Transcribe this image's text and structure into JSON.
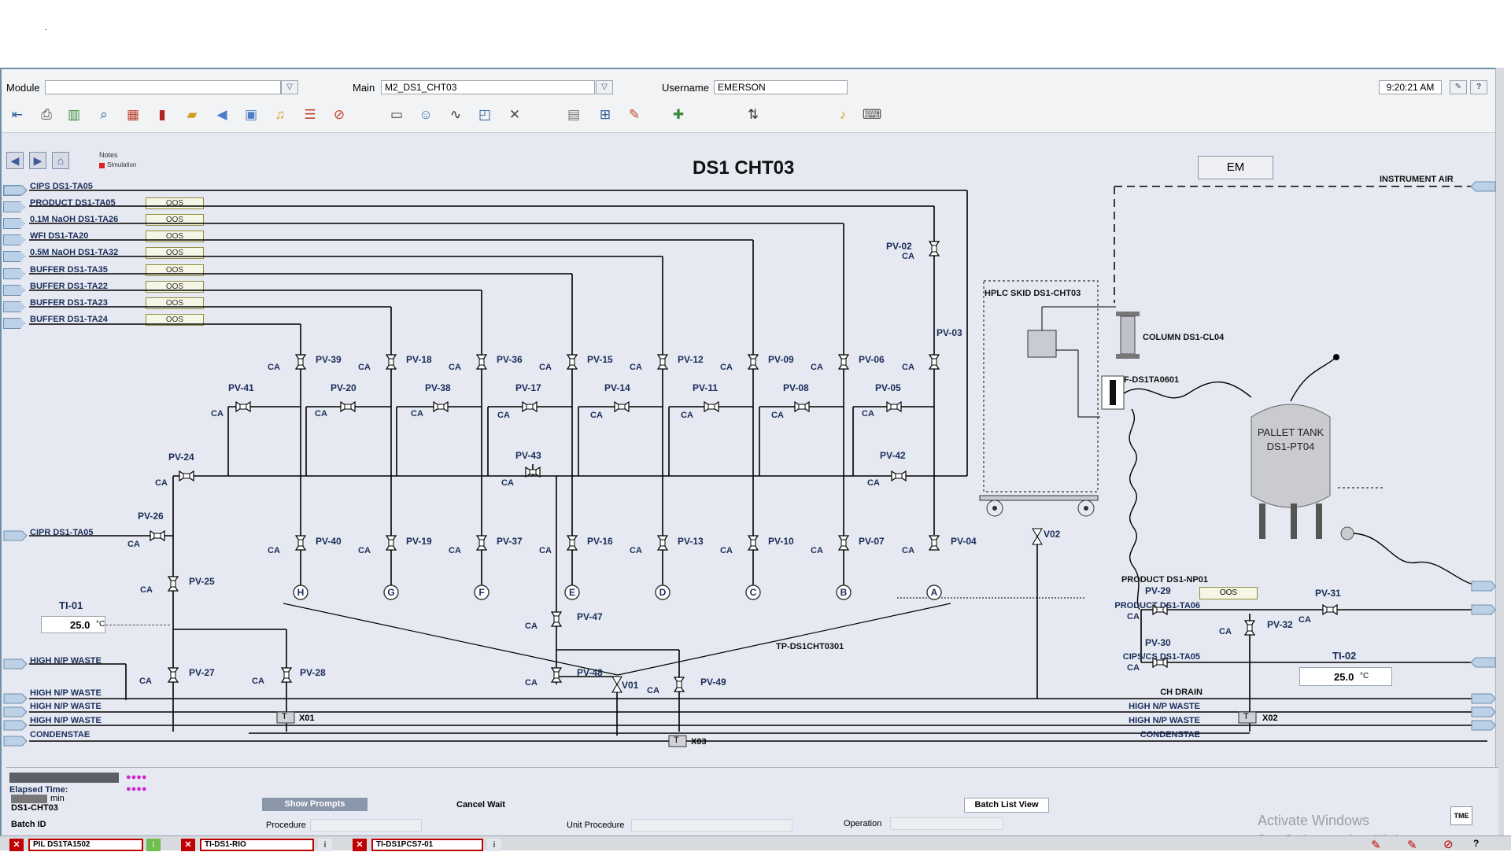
{
  "top_dot": ".",
  "header": {
    "module_label": "Module",
    "module_value": "",
    "main_label": "Main",
    "main_value": "M2_DS1_CHT03",
    "username_label": "Username",
    "username_value": "EMERSON",
    "time": "9:20:21 AM",
    "help": "?"
  },
  "nav": {
    "notes_label": "Notes",
    "simulation_label": "Simulation"
  },
  "display": {
    "title": "DS1 CHT03",
    "em_button": "EM"
  },
  "sources": [
    {
      "label": "CIPS DS1-TA05",
      "status": ""
    },
    {
      "label": "PRODUCT DS1-TA05",
      "status": "OOS"
    },
    {
      "label": "0.1M NaOH DS1-TA26",
      "status": "OOS"
    },
    {
      "label": "WFI DS1-TA20",
      "status": "OOS"
    },
    {
      "label": "0.5M NaOH DS1-TA32",
      "status": "OOS"
    },
    {
      "label": "BUFFER DS1-TA35",
      "status": "OOS"
    },
    {
      "label": "BUFFER DS1-TA22",
      "status": "OOS"
    },
    {
      "label": "BUFFER DS1-TA23",
      "status": "OOS"
    },
    {
      "label": "BUFFER DS1-TA24",
      "status": "OOS"
    }
  ],
  "valves": {
    "top_row": [
      "PV-39",
      "PV-18",
      "PV-36",
      "PV-15",
      "PV-12",
      "PV-09",
      "PV-06",
      "PV-03"
    ],
    "mid_row": [
      "PV-41",
      "PV-20",
      "PV-38",
      "PV-17",
      "PV-14",
      "PV-11",
      "PV-08",
      "PV-05"
    ],
    "bottom_row": [
      "PV-40",
      "PV-19",
      "PV-37",
      "PV-16",
      "PV-13",
      "PV-10",
      "PV-07",
      "PV-04"
    ],
    "ports": [
      "H",
      "G",
      "F",
      "E",
      "D",
      "C",
      "B",
      "A"
    ],
    "others": {
      "pv02": "PV-02",
      "pv24": "PV-24",
      "pv43": "PV-43",
      "pv42": "PV-42",
      "pv26": "PV-26",
      "pv25": "PV-25",
      "pv27": "PV-27",
      "pv28": "PV-28",
      "pv47": "PV-47",
      "pv48": "PV-48",
      "pv49": "PV-49",
      "v01": "V01",
      "v02": "V02",
      "pv29": "PV-29",
      "pv30": "PV-30",
      "pv31": "PV-31",
      "pv32": "PV-32"
    },
    "ca": "CA"
  },
  "equipment": {
    "hplc": "HPLC SKID DS1-CHT03",
    "column": "COLUMN DS1-CL04",
    "flow": "F-DS1TA0601",
    "tank_line1": "PALLET TANK",
    "tank_line2": "DS1-PT04",
    "tp": "TP-DS1CHT0301",
    "instrument_air": "INSTRUMENT AIR",
    "x01": "X01",
    "x02": "X02",
    "x03": "X03",
    "t": "T"
  },
  "indicators": {
    "ti01_label": "TI-01",
    "ti01_value": "25.0",
    "ti01_unit": "°C",
    "ti02_label": "TI-02",
    "ti02_value": "25.0",
    "ti02_unit": "°C",
    "oos_right": "OOS"
  },
  "left_lines": {
    "cipr": "CIPR DS1-TA05",
    "waste1": "HIGH N/P WASTE",
    "waste2": "HIGH N/P WASTE",
    "waste3": "HIGH N/P WASTE",
    "waste4": "HIGH N/P WASTE",
    "condensate": "CONDENSTAE"
  },
  "right_lines": {
    "product_np": "PRODUCT DS1-NP01",
    "product_ta06": "PRODUCT DS1-TA06",
    "cips_cs": "CIPS/CS DS1-TA05",
    "ch_drain": "CH DRAIN",
    "waste1": "HIGH N/P WASTE",
    "waste2": "HIGH N/P WASTE",
    "condensate": "CONDENSTAE"
  },
  "batch": {
    "elapsed_label": "Elapsed Time:",
    "elapsed_value": "min",
    "unit": "DS1-CHT03",
    "batch_id_label": "Batch ID",
    "show_prompts": "Show Prompts",
    "cancel_wait": "Cancel Wait",
    "batch_list_view": "Batch List View",
    "procedure_label": "Procedure",
    "unit_procedure_label": "Unit Procedure",
    "operation_label": "Operation",
    "tme": "TME",
    "dots": "●●●●"
  },
  "alarms": [
    {
      "label": "PIL DS1TA1502"
    },
    {
      "label": "TI-DS1-RIO"
    },
    {
      "label": "TI-DS1PCS7-01"
    }
  ],
  "windows": {
    "activate": "Activate Windows",
    "go_settings": "Go to Settings to activate Windows."
  },
  "colors": {
    "pipe": "#000000",
    "label": "#1a2d5a",
    "canvas": "#e6e9f1",
    "alarm": "#c00000"
  }
}
